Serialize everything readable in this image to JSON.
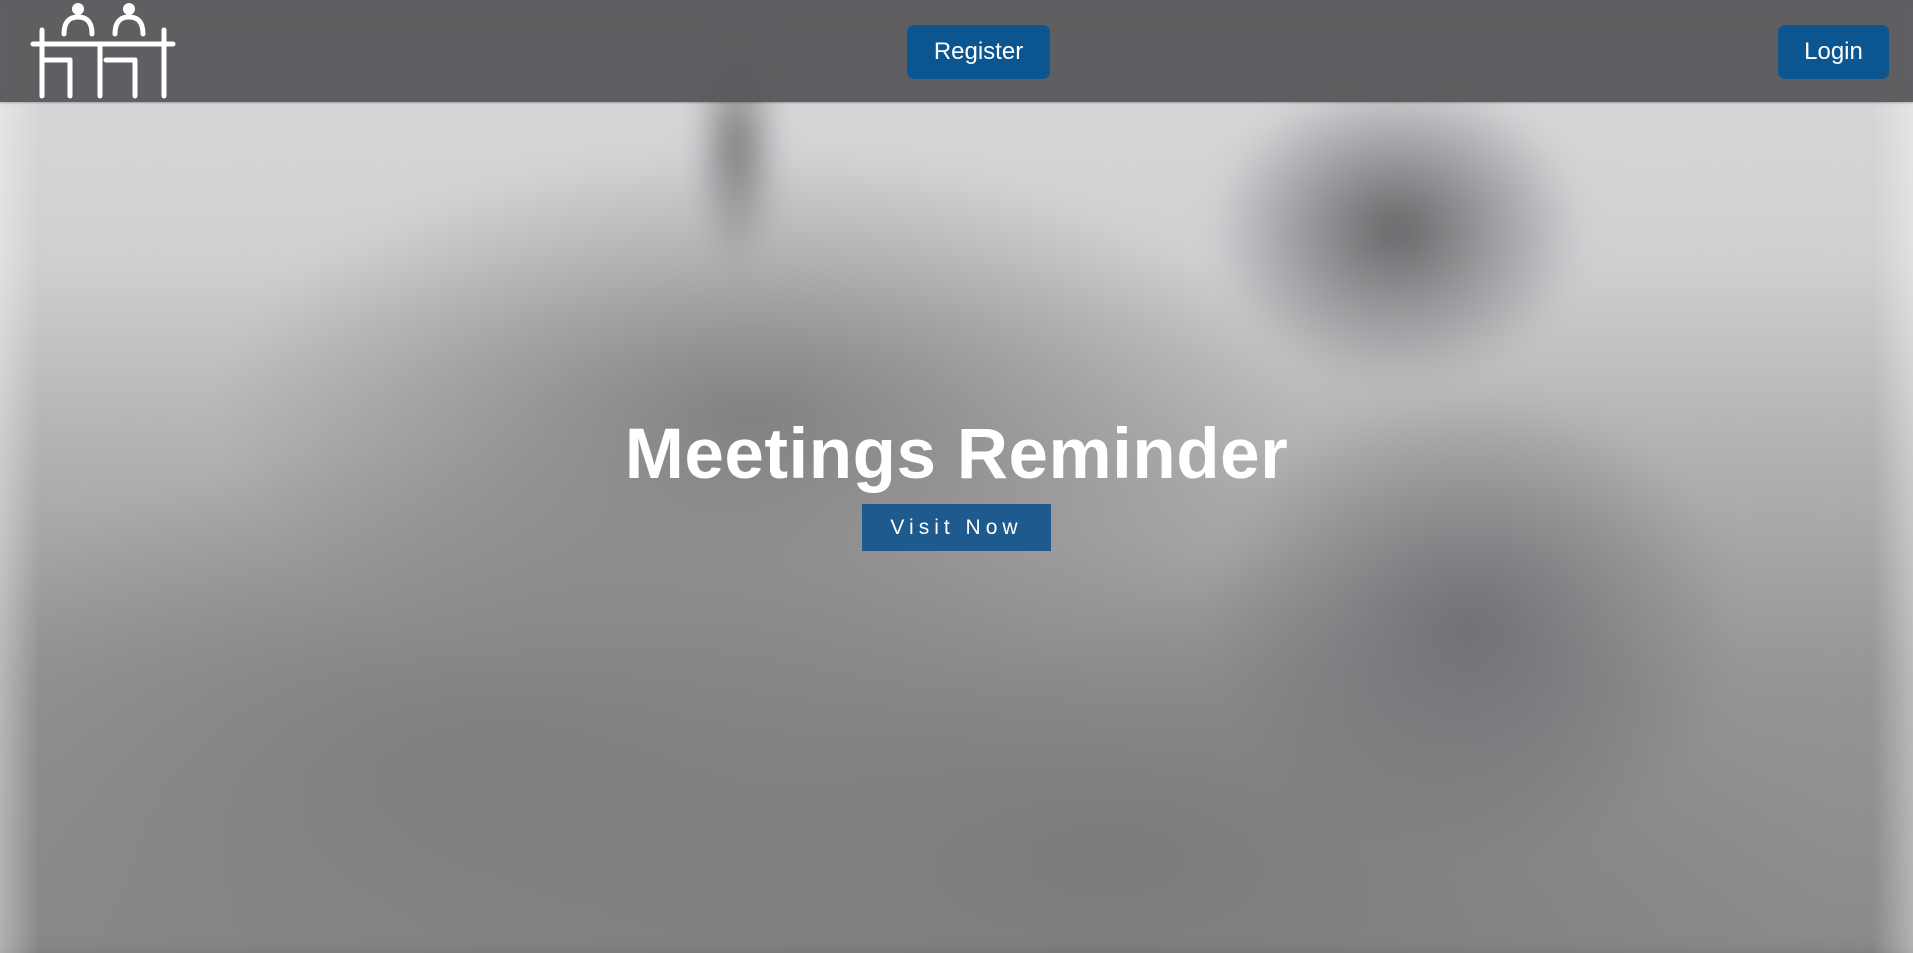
{
  "navbar": {
    "logo_icon": "meeting-people-table-icon",
    "register_label": "Register",
    "login_label": "Login",
    "button_color": "#0b5690",
    "background_color": "#555558"
  },
  "hero": {
    "title": "Meetings Reminder",
    "cta_label": "Visit Now",
    "cta_color": "#1e5a8d",
    "background": "blurred-photo"
  }
}
